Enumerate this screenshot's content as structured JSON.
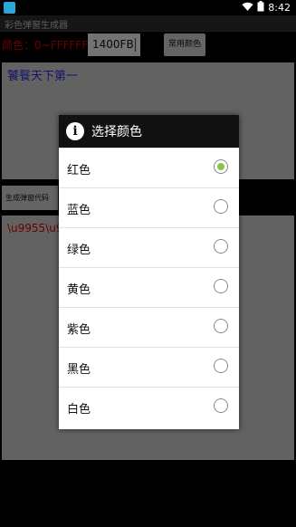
{
  "status_bar": {
    "time": "8:42",
    "battery_icon": "battery-icon",
    "wifi_icon": "wifi-icon",
    "app_icon": "app-icon"
  },
  "app": {
    "title": "彩色弹窗生成器"
  },
  "color_row": {
    "label": "颜色：0~FFFFFF",
    "input_value": "1400FB",
    "common_colors_button": "常用颜色"
  },
  "editor": {
    "text": "饕餮天下第一",
    "text_color": "#2a2ad0"
  },
  "generate_button": {
    "label": "生成弹窗代码"
  },
  "output": {
    "text": "\\u9955\\u9",
    "text_color": "#d40000"
  },
  "dialog": {
    "title": "选择颜色",
    "icon": "info-icon",
    "options": [
      {
        "label": "红色",
        "selected": true
      },
      {
        "label": "蓝色",
        "selected": false
      },
      {
        "label": "绿色",
        "selected": false
      },
      {
        "label": "黄色",
        "selected": false
      },
      {
        "label": "紫色",
        "selected": false
      },
      {
        "label": "黑色",
        "selected": false
      },
      {
        "label": "白色",
        "selected": false
      }
    ],
    "selected_radio_color": "#8bc34a"
  }
}
